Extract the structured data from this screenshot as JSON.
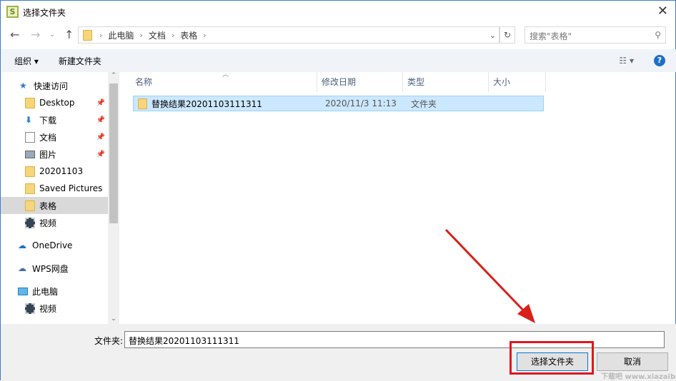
{
  "window": {
    "title": "选择文件夹",
    "app_icon": "S"
  },
  "address": {
    "crumbs": [
      "此电脑",
      "文档",
      "表格"
    ],
    "search_placeholder": "搜索\"表格\""
  },
  "toolbar": {
    "organize": "组织 ▾",
    "new_folder": "新建文件夹"
  },
  "sidebar": {
    "items": [
      {
        "label": "快速访问",
        "icon": "star-icon"
      },
      {
        "label": "Desktop",
        "icon": "folder-icon",
        "pinned": true
      },
      {
        "label": "下载",
        "icon": "download-icon",
        "pinned": true
      },
      {
        "label": "文档",
        "icon": "document-icon",
        "pinned": true
      },
      {
        "label": "图片",
        "icon": "picture-icon",
        "pinned": true
      },
      {
        "label": "20201103",
        "icon": "folder-icon"
      },
      {
        "label": "Saved Pictures",
        "icon": "folder-icon"
      },
      {
        "label": "表格",
        "icon": "folder-icon",
        "selected": true
      },
      {
        "label": "视频",
        "icon": "video-icon"
      },
      {
        "label": "OneDrive",
        "icon": "cloud-icon"
      },
      {
        "label": "WPS网盘",
        "icon": "cloud-outline-icon"
      },
      {
        "label": "此电脑",
        "icon": "computer-icon"
      },
      {
        "label": "视频",
        "icon": "video-icon"
      }
    ]
  },
  "columns": [
    "名称",
    "修改日期",
    "类型",
    "大小"
  ],
  "files": [
    {
      "name": "替换结果20201103111311",
      "date": "2020/11/3 11:13",
      "type": "文件夹",
      "size": ""
    }
  ],
  "footer": {
    "label": "文件夹:",
    "value": "替换结果20201103111311",
    "select": "选择文件夹",
    "cancel": "取消"
  },
  "watermark": "下载吧 www.xiazaiba.com"
}
